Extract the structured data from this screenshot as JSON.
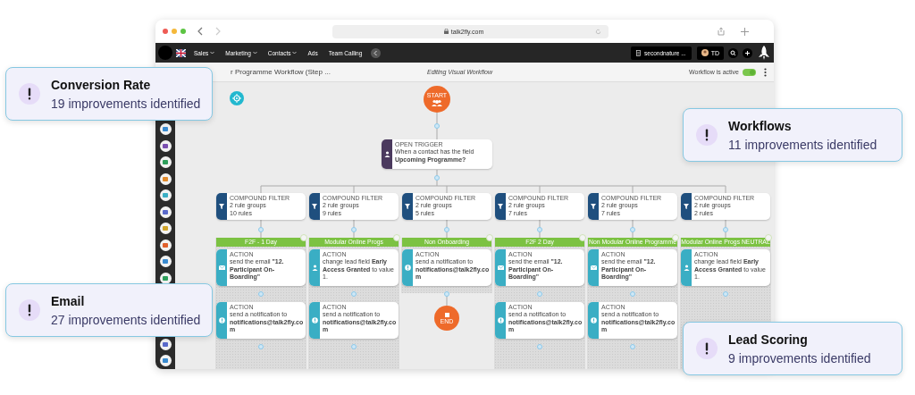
{
  "browser": {
    "address": "talk2fly.com"
  },
  "nav": {
    "menu": [
      {
        "label": "Sales",
        "dropdown": true
      },
      {
        "label": "Marketing",
        "dropdown": true
      },
      {
        "label": "Contacts",
        "dropdown": true
      },
      {
        "label": "Ads",
        "dropdown": false
      },
      {
        "label": "Team Calling",
        "dropdown": false
      }
    ],
    "account": "secondnature ...",
    "user": "TD"
  },
  "title_bar": {
    "title": "r Programme Workflow (Step ...",
    "mode": "Editing Visual Workflow",
    "status_label": "Workflow is active",
    "workflow_active": true
  },
  "workflow": {
    "start": {
      "label": "START"
    },
    "trigger": {
      "title": "OPEN TRIGGER",
      "line1": "When a contact has the field",
      "line2": "Upcoming Programme?"
    },
    "columns": [
      {
        "filter": {
          "title": "COMPOUND FILTER",
          "groups": "2 rule groups",
          "rules": "10 rules"
        },
        "branch": "F2F - 1 Day",
        "actions": [
          {
            "kind": "email",
            "title": "ACTION",
            "text": "send the email **\"12. Participant On-Boarding\"**"
          },
          {
            "kind": "notify",
            "title": "ACTION",
            "text": "send a notification to **notifications@talk2fly.com**"
          }
        ]
      },
      {
        "filter": {
          "title": "COMPOUND FILTER",
          "groups": "2 rule groups",
          "rules": "9 rules"
        },
        "branch": "Modular Online Progs",
        "actions": [
          {
            "kind": "field",
            "title": "ACTION",
            "text": "change lead field **Early Access Granted** to value 1."
          },
          {
            "kind": "notify",
            "title": "ACTION",
            "text": "send a notification to **notifications@talk2fly.com**"
          }
        ]
      },
      {
        "filter": {
          "title": "COMPOUND FILTER",
          "groups": "2 rule groups",
          "rules": "5 rules"
        },
        "branch": "Non Onboarding",
        "actions": [
          {
            "kind": "notify",
            "title": "ACTION",
            "text": "send a notification to **notifications@talk2fly.com**"
          }
        ],
        "end": {
          "label": "END"
        }
      },
      {
        "filter": {
          "title": "COMPOUND FILTER",
          "groups": "2 rule groups",
          "rules": "7 rules"
        },
        "branch": "F2F 2 Day",
        "actions": [
          {
            "kind": "email",
            "title": "ACTION",
            "text": "send the email **\"12. Participant On-Boarding\"**"
          },
          {
            "kind": "notify",
            "title": "ACTION",
            "text": "send a notification to **notifications@talk2fly.com**"
          }
        ]
      },
      {
        "filter": {
          "title": "COMPOUND FILTER",
          "groups": "2 rule groups",
          "rules": "7 rules"
        },
        "branch": "Non Modular Online Programme",
        "actions": [
          {
            "kind": "email",
            "title": "ACTION",
            "text": "send the email **\"12. Participant On-Boarding\"**"
          },
          {
            "kind": "notify",
            "title": "ACTION",
            "text": "send a notification to **notifications@talk2fly.com**"
          }
        ]
      },
      {
        "filter": {
          "title": "COMPOUND FILTER",
          "groups": "2 rule groups",
          "rules": "2 rules"
        },
        "branch": "Modular Online Progs NEUTRAL",
        "actions": [
          {
            "kind": "field",
            "title": "ACTION",
            "text": "change lead field **Early Access Granted** to value 1."
          }
        ]
      }
    ]
  },
  "callouts": [
    {
      "title": "Conversion Rate",
      "text": "19 improvements identified"
    },
    {
      "title": "Workflows",
      "text": "11 improvements identified"
    },
    {
      "title": "Email",
      "text": "27 improvements identified"
    },
    {
      "title": "Lead Scoring",
      "text": "9 improvements identified"
    }
  ]
}
